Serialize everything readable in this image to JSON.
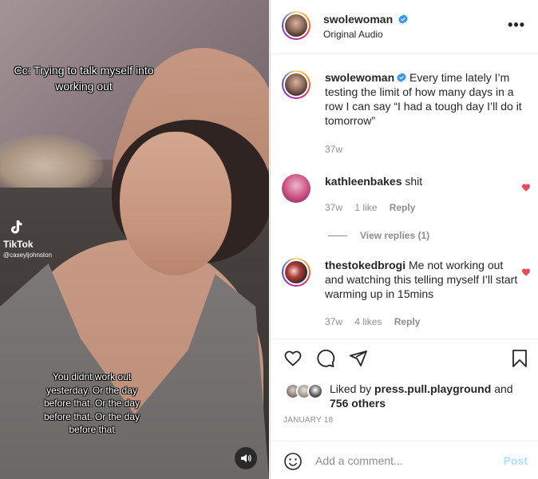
{
  "video": {
    "caption_top": "Cc: Trying to talk myself into working out",
    "caption_bottom": "You didnt work out yesterday. Or the day before that. Or the day before that. Or the day before that",
    "watermark_brand": "TikTok",
    "watermark_user": "@caseyljohnston",
    "sound_icon": "speaker-icon"
  },
  "header": {
    "username": "swolewoman",
    "subtitle": "Original Audio",
    "more_icon": "more-icon",
    "more_label": "•••"
  },
  "caption": {
    "username": "swolewoman",
    "text": "Every time lately I’m testing the limit of how many days in a row I can say “I had a tough day I’ll do it tomorrow”",
    "age": "37w"
  },
  "comments": [
    {
      "username": "kathleenbakes",
      "text": "shit",
      "age": "37w",
      "likes": "1 like",
      "reply": "Reply"
    },
    {
      "username": "thestokedbrogi",
      "text": "Me not working out and watching this telling myself I’ll start warming up in 15mins",
      "age": "37w",
      "likes": "4 likes",
      "reply": "Reply"
    }
  ],
  "view_replies": "View replies (1)",
  "likes": {
    "prefix": "Liked by",
    "user": "press.pull.playground",
    "middle": "and",
    "others": "756 others"
  },
  "date": "JANUARY 18",
  "add_comment": {
    "placeholder": "Add a comment...",
    "post_label": "Post"
  },
  "colors": {
    "verified": "#3897f0",
    "heart": "#ed4956",
    "post_disabled": "#b2dffc",
    "muted": "#8e8e8e"
  }
}
